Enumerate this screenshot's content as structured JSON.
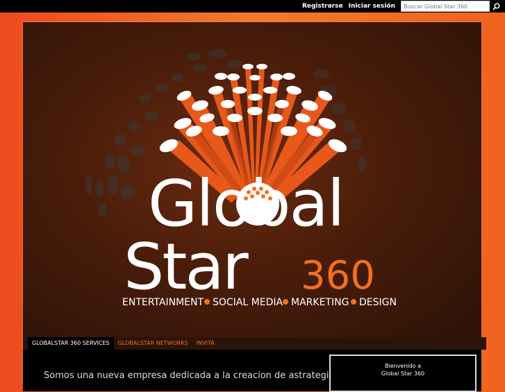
{
  "topbar": {
    "register_label": "Registrarse",
    "login_label": "Iniciar sesión",
    "search_placeholder": "Buscar Global Star 360"
  },
  "hero": {
    "logo_line1": "Global",
    "logo_line2": "Star",
    "logo_number": "360",
    "tagline": [
      "ENTERTAINMENT",
      "SOCIAL MEDIA",
      "MARKETING",
      "DESIGN"
    ],
    "colors": {
      "accent": "#f26f21",
      "text": "#ffffff",
      "background": "#2c1208"
    }
  },
  "nav": {
    "items": [
      {
        "label": "GLOBALSTAR 360 SERVICES",
        "active": true
      },
      {
        "label": "GLOBALSTAR NETWORKS",
        "active": false
      },
      {
        "label": "INVITA",
        "active": false
      }
    ]
  },
  "main": {
    "intro": "Somos una nueva empresa dedicada a la creacion de astrategias de"
  },
  "sidebar": {
    "welcome_line1": "Bienvenido a",
    "welcome_line2": "Global Star 360"
  }
}
